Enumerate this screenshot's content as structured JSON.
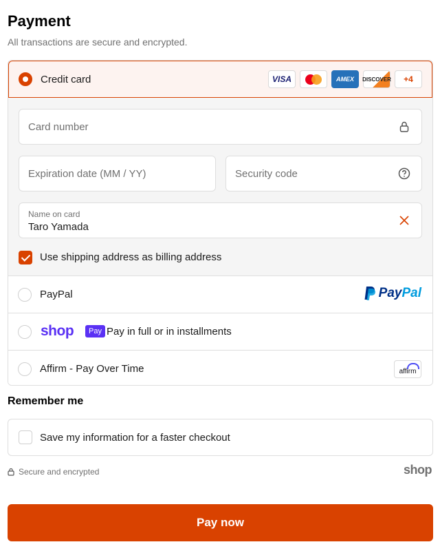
{
  "header": {
    "title": "Payment",
    "subtitle": "All transactions are secure and encrypted."
  },
  "payment_methods": {
    "credit_card": {
      "label": "Credit card",
      "selected": true,
      "card_logos": [
        "VISA",
        "mastercard",
        "AMEX",
        "DISCOVER"
      ],
      "more_cards": "+4"
    },
    "card_form": {
      "card_number_placeholder": "Card number",
      "expiration_placeholder": "Expiration date (MM / YY)",
      "security_code_placeholder": "Security code",
      "name_label": "Name on card",
      "name_value": "Taro Yamada",
      "billing_checkbox_label": "Use shipping address as billing address",
      "billing_checked": true
    },
    "paypal": {
      "label": "PayPal",
      "logo_text_1": "Pay",
      "logo_text_2": "Pal"
    },
    "shop_pay": {
      "logo_word": "shop",
      "badge": "Pay",
      "label": "Pay in full or in installments"
    },
    "affirm": {
      "label": "Affirm - Pay Over Time",
      "logo_text": "affirm"
    }
  },
  "remember": {
    "title": "Remember me",
    "checkbox_label": "Save my information for a faster checkout",
    "checked": false
  },
  "footer": {
    "secure_text": "Secure and encrypted",
    "shop_logo": "shop"
  },
  "pay_button_label": "Pay now",
  "colors": {
    "accent": "#d94200",
    "shop_purple": "#5a31f4",
    "paypal_dark": "#003087",
    "paypal_light": "#009cde"
  }
}
